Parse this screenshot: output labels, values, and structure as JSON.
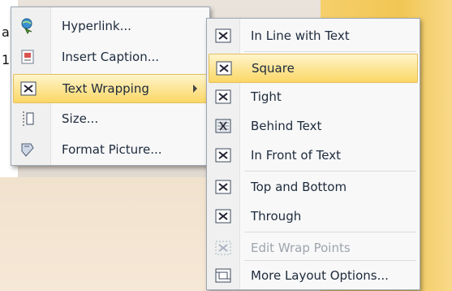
{
  "background": {
    "fragment_a": "a",
    "fragment_1": "1"
  },
  "context_menu": {
    "items": [
      {
        "label": "Hyperlink...",
        "icon": "hyperlink-globe-icon"
      },
      {
        "label": "Insert Caption...",
        "icon": "caption-icon"
      },
      {
        "label": "Text Wrapping",
        "icon": "text-wrapping-icon",
        "highlighted": true,
        "has_submenu": true
      },
      {
        "label": "Size...",
        "icon": "size-icon"
      },
      {
        "label": "Format Picture...",
        "icon": "format-picture-icon"
      }
    ]
  },
  "wrap_submenu": {
    "items": [
      {
        "label": "In Line with Text",
        "icon": "inline-wrap-icon"
      },
      {
        "label": "Square",
        "icon": "square-wrap-icon",
        "highlighted": true
      },
      {
        "label": "Tight",
        "icon": "tight-wrap-icon"
      },
      {
        "label": "Behind Text",
        "icon": "behind-text-icon"
      },
      {
        "label": "In Front of Text",
        "icon": "in-front-of-text-icon"
      },
      {
        "label": "Top and Bottom",
        "icon": "top-bottom-wrap-icon"
      },
      {
        "label": "Through",
        "icon": "through-wrap-icon"
      },
      {
        "label": "Edit Wrap Points",
        "icon": "edit-wrap-points-icon",
        "disabled": true
      },
      {
        "label": "More Layout Options...",
        "icon": "layout-options-icon"
      }
    ]
  },
  "colors": {
    "highlight": "#fbd766",
    "menu_bg": "#f8f8f8",
    "menu_border": "#9da7b3",
    "disabled_text": "#9ea4ad"
  }
}
